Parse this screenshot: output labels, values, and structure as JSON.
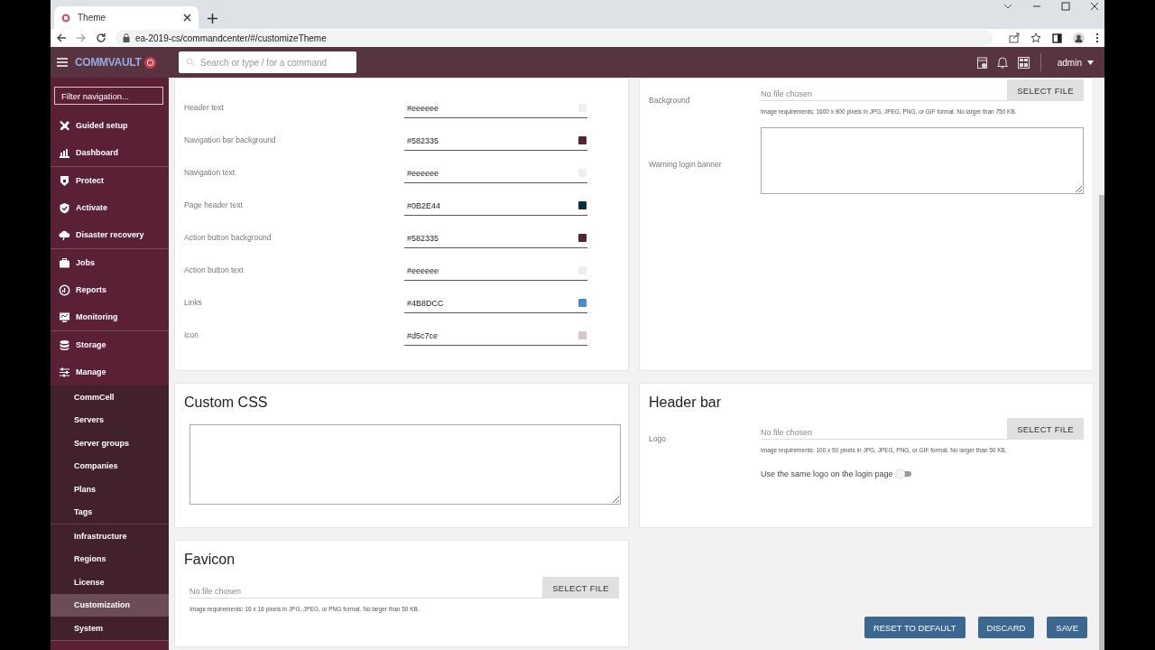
{
  "browser": {
    "tab_title": "Theme",
    "url": "ea-2019-cs/commandcenter/#/customizeTheme"
  },
  "header": {
    "brand": "COMMVAULT",
    "search_placeholder": "Search or type / for a command",
    "user": "admin"
  },
  "sidebar": {
    "filter_placeholder": "Filter navigation...",
    "sections": [
      {
        "items": [
          {
            "label": "Guided setup",
            "kind": "tools",
            "selected": false
          },
          {
            "label": "Dashboard",
            "kind": "dashboard",
            "selected": false
          }
        ]
      },
      {
        "items": [
          {
            "label": "Protect",
            "kind": "protect",
            "selected": false
          },
          {
            "label": "Activate",
            "kind": "shield",
            "selected": false
          },
          {
            "label": "Disaster recovery",
            "kind": "cloud",
            "selected": false
          }
        ]
      },
      {
        "items": [
          {
            "label": "Jobs",
            "kind": "briefcase",
            "selected": false
          },
          {
            "label": "Reports",
            "kind": "gauge",
            "selected": false
          },
          {
            "label": "Monitoring",
            "kind": "monitor",
            "selected": false
          }
        ]
      },
      {
        "items": [
          {
            "label": "Storage",
            "kind": "database",
            "selected": false
          },
          {
            "label": "Manage",
            "kind": "sliders",
            "selected": false,
            "expanded": true,
            "subsections": [
              {
                "items": [
                  {
                    "label": "CommCell",
                    "selected": false
                  },
                  {
                    "label": "Servers",
                    "selected": false
                  },
                  {
                    "label": "Server groups",
                    "selected": false
                  },
                  {
                    "label": "Companies",
                    "selected": false
                  },
                  {
                    "label": "Plans",
                    "selected": false
                  },
                  {
                    "label": "Tags",
                    "selected": false
                  }
                ]
              },
              {
                "items": [
                  {
                    "label": "Infrastructure",
                    "selected": false
                  },
                  {
                    "label": "Regions",
                    "selected": false
                  },
                  {
                    "label": "License",
                    "selected": false
                  },
                  {
                    "label": "Customization",
                    "selected": true
                  },
                  {
                    "label": "System",
                    "selected": false
                  }
                ]
              }
            ]
          }
        ]
      }
    ]
  },
  "theme_colors": {
    "rows": [
      {
        "label": "Header text",
        "value": "#eeeeee",
        "color": "#eeeeee"
      },
      {
        "label": "Navigation bar background",
        "value": "#582335",
        "color": "#582335"
      },
      {
        "label": "Navigation text",
        "value": "#eeeeee",
        "color": "#eeeeee"
      },
      {
        "label": "Page header text",
        "value": "#0B2E44",
        "color": "#0b2e44"
      },
      {
        "label": "Action button background",
        "value": "#582335",
        "color": "#582335"
      },
      {
        "label": "Action button text",
        "value": "#eeeeee",
        "color": "#eeeeee"
      },
      {
        "label": "Links",
        "value": "#4B8DCC",
        "color": "#4b8dcc"
      },
      {
        "label": "Icon",
        "value": "#d5c7ce",
        "color": "#d5c7ce"
      }
    ]
  },
  "login_page": {
    "fields": [
      {
        "kind": "file",
        "label": "Background",
        "file_status": "No file chosen",
        "button": "SELECT FILE",
        "requirements": "Image requirements: 1600 x 900 pixels in JPG, JPEG, PNG, or GIF format. No larger than 750 KB."
      },
      {
        "kind": "textarea",
        "label": "Warning login banner"
      }
    ]
  },
  "custom_css": {
    "title": "Custom CSS",
    "fields": [
      {
        "kind": "textarea"
      }
    ]
  },
  "header_bar": {
    "title": "Header bar",
    "fields": [
      {
        "kind": "file",
        "label": "Logo",
        "file_status": "No file chosen",
        "button": "SELECT FILE",
        "requirements": "Image requirements: 100 x 50 pixels in JPG, JPEG, PNG, or GIF format. No larger than 50 KB."
      },
      {
        "kind": "toggle",
        "label": "Use the same logo on the login page",
        "on": false
      }
    ]
  },
  "favicon": {
    "title": "Favicon",
    "fields": [
      {
        "kind": "file",
        "file_status": "No file chosen",
        "button": "SELECT FILE",
        "requirements": "Image requirements: 16 x 16 pixels in JPG, JPEG, or PNG format. No larger than 50 KB."
      }
    ]
  },
  "actions": [
    "RESET TO DEFAULT",
    "DISCARD",
    "SAVE"
  ]
}
